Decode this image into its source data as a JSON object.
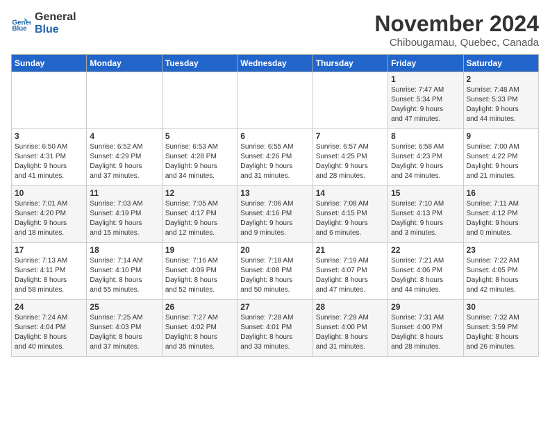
{
  "logo": {
    "line1": "General",
    "line2": "Blue"
  },
  "title": "November 2024",
  "location": "Chibougamau, Quebec, Canada",
  "headers": [
    "Sunday",
    "Monday",
    "Tuesday",
    "Wednesday",
    "Thursday",
    "Friday",
    "Saturday"
  ],
  "weeks": [
    [
      {
        "day": "",
        "info": ""
      },
      {
        "day": "",
        "info": ""
      },
      {
        "day": "",
        "info": ""
      },
      {
        "day": "",
        "info": ""
      },
      {
        "day": "",
        "info": ""
      },
      {
        "day": "1",
        "info": "Sunrise: 7:47 AM\nSunset: 5:34 PM\nDaylight: 9 hours\nand 47 minutes."
      },
      {
        "day": "2",
        "info": "Sunrise: 7:48 AM\nSunset: 5:33 PM\nDaylight: 9 hours\nand 44 minutes."
      }
    ],
    [
      {
        "day": "3",
        "info": "Sunrise: 6:50 AM\nSunset: 4:31 PM\nDaylight: 9 hours\nand 41 minutes."
      },
      {
        "day": "4",
        "info": "Sunrise: 6:52 AM\nSunset: 4:29 PM\nDaylight: 9 hours\nand 37 minutes."
      },
      {
        "day": "5",
        "info": "Sunrise: 6:53 AM\nSunset: 4:28 PM\nDaylight: 9 hours\nand 34 minutes."
      },
      {
        "day": "6",
        "info": "Sunrise: 6:55 AM\nSunset: 4:26 PM\nDaylight: 9 hours\nand 31 minutes."
      },
      {
        "day": "7",
        "info": "Sunrise: 6:57 AM\nSunset: 4:25 PM\nDaylight: 9 hours\nand 28 minutes."
      },
      {
        "day": "8",
        "info": "Sunrise: 6:58 AM\nSunset: 4:23 PM\nDaylight: 9 hours\nand 24 minutes."
      },
      {
        "day": "9",
        "info": "Sunrise: 7:00 AM\nSunset: 4:22 PM\nDaylight: 9 hours\nand 21 minutes."
      }
    ],
    [
      {
        "day": "10",
        "info": "Sunrise: 7:01 AM\nSunset: 4:20 PM\nDaylight: 9 hours\nand 18 minutes."
      },
      {
        "day": "11",
        "info": "Sunrise: 7:03 AM\nSunset: 4:19 PM\nDaylight: 9 hours\nand 15 minutes."
      },
      {
        "day": "12",
        "info": "Sunrise: 7:05 AM\nSunset: 4:17 PM\nDaylight: 9 hours\nand 12 minutes."
      },
      {
        "day": "13",
        "info": "Sunrise: 7:06 AM\nSunset: 4:16 PM\nDaylight: 9 hours\nand 9 minutes."
      },
      {
        "day": "14",
        "info": "Sunrise: 7:08 AM\nSunset: 4:15 PM\nDaylight: 9 hours\nand 6 minutes."
      },
      {
        "day": "15",
        "info": "Sunrise: 7:10 AM\nSunset: 4:13 PM\nDaylight: 9 hours\nand 3 minutes."
      },
      {
        "day": "16",
        "info": "Sunrise: 7:11 AM\nSunset: 4:12 PM\nDaylight: 9 hours\nand 0 minutes."
      }
    ],
    [
      {
        "day": "17",
        "info": "Sunrise: 7:13 AM\nSunset: 4:11 PM\nDaylight: 8 hours\nand 58 minutes."
      },
      {
        "day": "18",
        "info": "Sunrise: 7:14 AM\nSunset: 4:10 PM\nDaylight: 8 hours\nand 55 minutes."
      },
      {
        "day": "19",
        "info": "Sunrise: 7:16 AM\nSunset: 4:09 PM\nDaylight: 8 hours\nand 52 minutes."
      },
      {
        "day": "20",
        "info": "Sunrise: 7:18 AM\nSunset: 4:08 PM\nDaylight: 8 hours\nand 50 minutes."
      },
      {
        "day": "21",
        "info": "Sunrise: 7:19 AM\nSunset: 4:07 PM\nDaylight: 8 hours\nand 47 minutes."
      },
      {
        "day": "22",
        "info": "Sunrise: 7:21 AM\nSunset: 4:06 PM\nDaylight: 8 hours\nand 44 minutes."
      },
      {
        "day": "23",
        "info": "Sunrise: 7:22 AM\nSunset: 4:05 PM\nDaylight: 8 hours\nand 42 minutes."
      }
    ],
    [
      {
        "day": "24",
        "info": "Sunrise: 7:24 AM\nSunset: 4:04 PM\nDaylight: 8 hours\nand 40 minutes."
      },
      {
        "day": "25",
        "info": "Sunrise: 7:25 AM\nSunset: 4:03 PM\nDaylight: 8 hours\nand 37 minutes."
      },
      {
        "day": "26",
        "info": "Sunrise: 7:27 AM\nSunset: 4:02 PM\nDaylight: 8 hours\nand 35 minutes."
      },
      {
        "day": "27",
        "info": "Sunrise: 7:28 AM\nSunset: 4:01 PM\nDaylight: 8 hours\nand 33 minutes."
      },
      {
        "day": "28",
        "info": "Sunrise: 7:29 AM\nSunset: 4:00 PM\nDaylight: 8 hours\nand 31 minutes."
      },
      {
        "day": "29",
        "info": "Sunrise: 7:31 AM\nSunset: 4:00 PM\nDaylight: 8 hours\nand 28 minutes."
      },
      {
        "day": "30",
        "info": "Sunrise: 7:32 AM\nSunset: 3:59 PM\nDaylight: 8 hours\nand 26 minutes."
      }
    ]
  ]
}
